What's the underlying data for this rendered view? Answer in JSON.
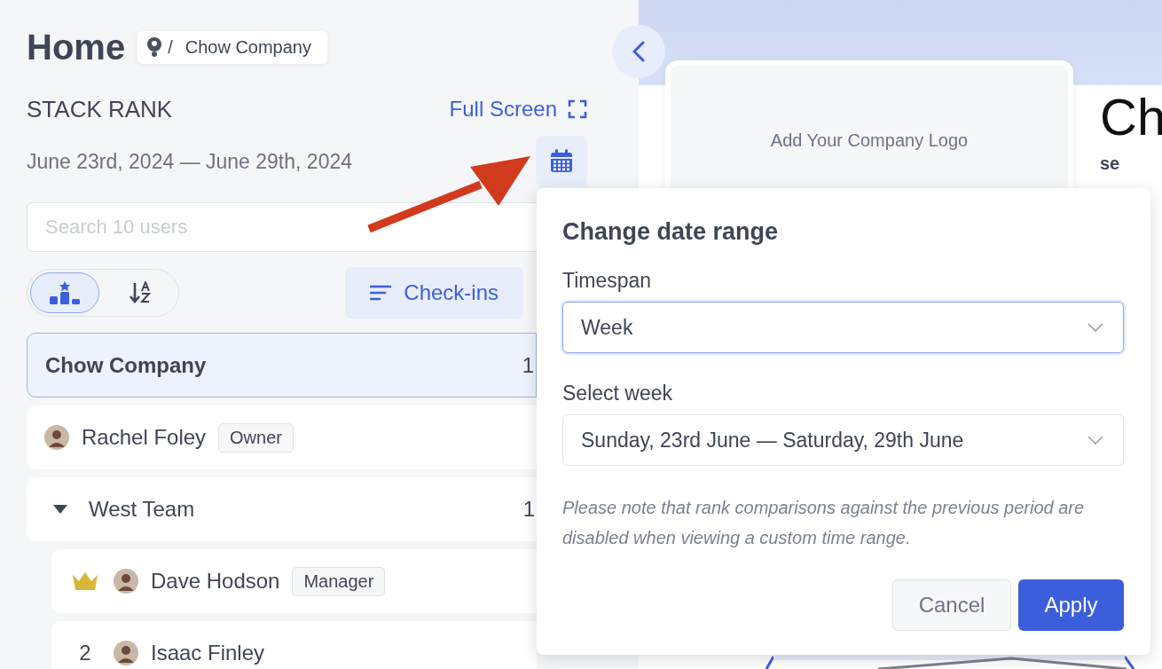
{
  "header": {
    "title": "Home",
    "breadcrumb_separator": "/",
    "breadcrumb": "Chow Company"
  },
  "stack_rank": {
    "title": "STACK RANK",
    "full_screen": "Full Screen",
    "date_range": "June 23rd, 2024 — June 29th, 2024"
  },
  "search": {
    "placeholder": "Search 10 users"
  },
  "view_toggle": [
    {
      "kind": "podium",
      "selected": true
    },
    {
      "kind": "sort",
      "selected": false
    }
  ],
  "filter_button": "Check-ins",
  "rows": [
    {
      "kind": "group",
      "name": "Chow Company",
      "score": "1",
      "selected": true
    },
    {
      "kind": "person",
      "name": "Rachel Foley",
      "role": "Owner",
      "selected": false
    },
    {
      "kind": "team",
      "name": "West Team",
      "score": "1",
      "expanded": true,
      "selected": false,
      "children": [
        {
          "kind": "person",
          "name": "Dave Hodson",
          "role": "Manager",
          "leader": true,
          "selected": false
        },
        {
          "kind": "person",
          "name": "Isaac Finley",
          "rank": "2",
          "leader": false,
          "selected": false
        }
      ]
    }
  ],
  "profile": {
    "logo_placeholder": "Add Your Company Logo",
    "heading": "Ch",
    "subtext": "se"
  },
  "popup": {
    "title": "Change date range",
    "fields": [
      {
        "label": "Timespan",
        "value": "Week",
        "focused": true
      },
      {
        "label": "Select week",
        "value": "Sunday, 23rd June — Saturday, 29th June",
        "focused": false
      }
    ],
    "note": "Please note that rank comparisons against the previous period are disabled when viewing a custom time range.",
    "buttons": [
      {
        "label": "Cancel",
        "kind": "secondary"
      },
      {
        "label": "Apply",
        "kind": "primary"
      }
    ]
  }
}
